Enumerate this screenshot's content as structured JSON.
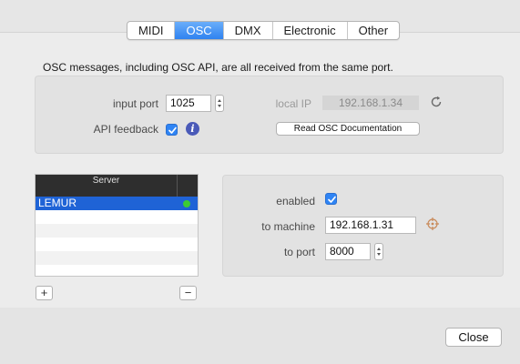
{
  "tabs": [
    {
      "label": "MIDI",
      "selected": false
    },
    {
      "label": "OSC",
      "selected": true
    },
    {
      "label": "DMX",
      "selected": false
    },
    {
      "label": "Electronic",
      "selected": false
    },
    {
      "label": "Other",
      "selected": false
    }
  ],
  "info_text": "OSC messages, including OSC API, are all received from the same port.",
  "input_port": {
    "label": "input port",
    "value": "1025"
  },
  "api_feedback": {
    "label": "API feedback",
    "checked": true
  },
  "local_ip": {
    "label": "local IP",
    "value": "192.168.1.34"
  },
  "read_doc_button": "Read OSC Documentation",
  "server_list": {
    "header": "Server",
    "rows": [
      {
        "name": "LEMUR",
        "selected": true,
        "status_color": "#3ccb35"
      }
    ]
  },
  "add_button": "+",
  "remove_button": "−",
  "server_settings": {
    "enabled": {
      "label": "enabled",
      "checked": true
    },
    "to_machine": {
      "label": "to machine",
      "value": "192.168.1.31"
    },
    "to_port": {
      "label": "to port",
      "value": "8000"
    }
  },
  "close_button": "Close",
  "colors": {
    "accent": "#2f82f0",
    "selection": "#1f63d6",
    "status_ok": "#3ccb35",
    "info_icon": "#4a5ab8"
  }
}
